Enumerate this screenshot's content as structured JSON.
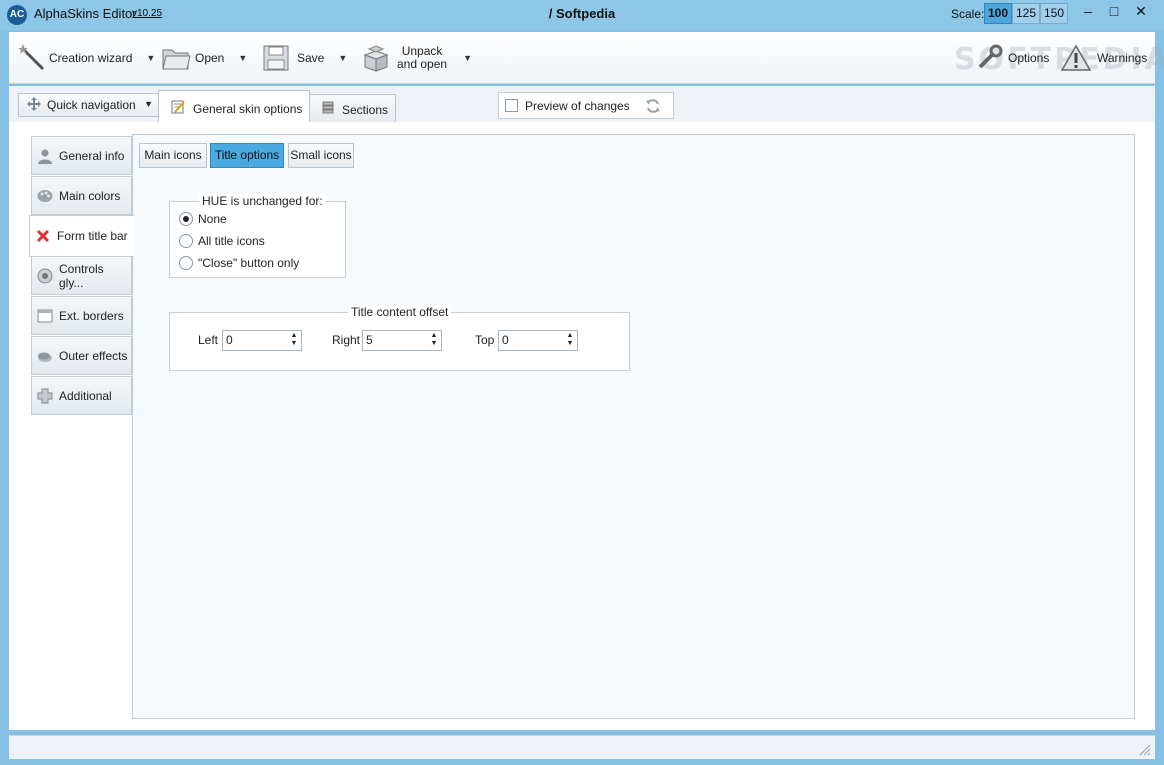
{
  "titlebar": {
    "app_title": "AlphaSkins Editor",
    "version": "v10.25",
    "document_title": "/ Softpedia",
    "scale_label": "Scale:",
    "scale_options": [
      "100",
      "125",
      "150"
    ],
    "scale_selected": "100",
    "minimize": "–",
    "maximize": "□",
    "close": "✕"
  },
  "toolbar": {
    "creation_wizard": "Creation wizard",
    "open": "Open",
    "save": "Save",
    "unpack_line1": "Unpack",
    "unpack_line2": "and open",
    "options": "Options",
    "warnings": "Warnings",
    "watermark": "SOFTPEDIA"
  },
  "nav": {
    "quick_navigation": "Quick navigation",
    "tabs": [
      {
        "label": "General  skin options",
        "active": true
      },
      {
        "label": "Sections",
        "active": false
      }
    ],
    "preview_label": "Preview of changes",
    "preview_checked": false
  },
  "sidebar": {
    "items": [
      {
        "label": "General info",
        "icon": "user-icon",
        "active": false
      },
      {
        "label": "Main colors",
        "icon": "palette-icon",
        "active": false
      },
      {
        "label": "Form title bar",
        "icon": "close-x-icon",
        "active": true
      },
      {
        "label": "Controls gly...",
        "icon": "radio-glyph-icon",
        "active": false
      },
      {
        "label": "Ext. borders",
        "icon": "window-border-icon",
        "active": false
      },
      {
        "label": "Outer effects",
        "icon": "shadow-icon",
        "active": false
      },
      {
        "label": "Additional",
        "icon": "plus-icon",
        "active": false
      }
    ]
  },
  "subtabs": [
    {
      "label": "Main icons",
      "active": false
    },
    {
      "label": "Title options",
      "active": true
    },
    {
      "label": "Small icons",
      "active": false
    }
  ],
  "hue_group": {
    "legend": "HUE is unchanged for:",
    "options": [
      {
        "label": "None",
        "checked": true
      },
      {
        "label": "All title icons",
        "checked": false
      },
      {
        "label": "\"Close\" button only",
        "checked": false
      }
    ]
  },
  "offset_group": {
    "legend": "Title content offset",
    "left_label": "Left",
    "left_value": "0",
    "right_label": "Right",
    "right_value": "5",
    "top_label": "Top",
    "top_value": "0"
  },
  "colors": {
    "titlebar_bg": "#8dc6e6",
    "accent": "#4aa9e0",
    "panel_bg": "#f7fafc"
  }
}
